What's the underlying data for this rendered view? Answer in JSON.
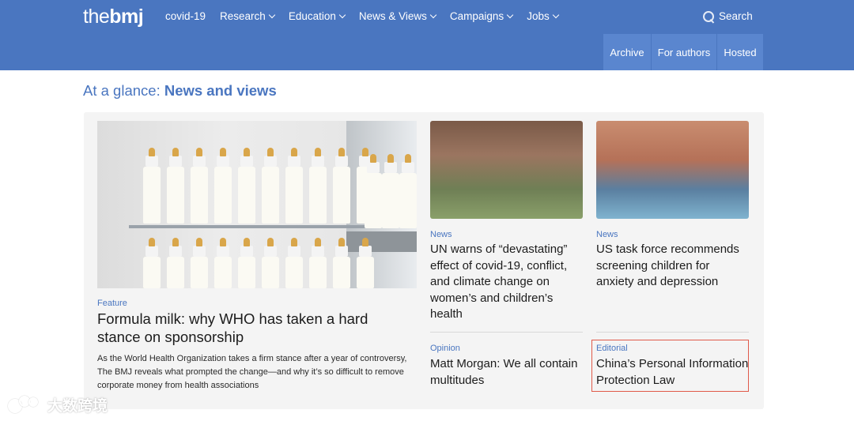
{
  "header": {
    "logo_the": "the",
    "logo_bmj": "bmj",
    "nav": [
      {
        "label": "covid-19",
        "has_dropdown": false
      },
      {
        "label": "Research",
        "has_dropdown": true
      },
      {
        "label": "Education",
        "has_dropdown": true
      },
      {
        "label": "News & Views",
        "has_dropdown": true
      },
      {
        "label": "Campaigns",
        "has_dropdown": true
      },
      {
        "label": "Jobs",
        "has_dropdown": true
      }
    ],
    "search_label": "Search",
    "subnav": [
      "Archive",
      "For authors",
      "Hosted"
    ]
  },
  "section": {
    "prefix": "At a glance: ",
    "title": "News and views"
  },
  "feature": {
    "label": "Feature",
    "title": "Formula milk: why WHO has taken a hard stance on sponsorship",
    "description": "As the World Health Organization takes a firm stance after a year of controversy, The BMJ reveals what prompted the change—and why it’s so difficult to remove corporate money from health associations"
  },
  "cards": [
    {
      "label": "News",
      "title": "UN warns of “devastating” effect of covid-19, conflict, and climate change on women’s and children’s health"
    },
    {
      "label": "News",
      "title": "US task force recommends screening children for anxiety and depression"
    },
    {
      "label": "Opinion",
      "title": "Matt Morgan: We all contain multitudes"
    },
    {
      "label": "Editorial",
      "title": "China’s Personal Information Protection Law"
    }
  ],
  "watermark": "大数跨境",
  "colors": {
    "brand_blue": "#4a76c0",
    "subnav_blue": "#5a86cf",
    "highlight_red": "#e05a4a"
  }
}
